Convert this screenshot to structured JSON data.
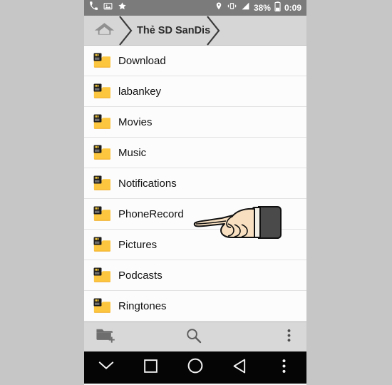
{
  "statusbar": {
    "left_icons": [
      "phone-handset-icon",
      "picture-icon",
      "star-icon"
    ],
    "right_icons": [
      "location-pin-icon",
      "vibrate-icon",
      "signal-bars-icon",
      "battery-icon"
    ],
    "battery_percent": "38%",
    "clock": "0:09"
  },
  "breadcrumb": {
    "home_icon": "home-icon",
    "items": [
      {
        "label": "Thẻ SD SanDis"
      }
    ]
  },
  "filelist": {
    "items": [
      {
        "name": "Download",
        "icon": "sd-folder-icon"
      },
      {
        "name": "labankey",
        "icon": "sd-folder-icon"
      },
      {
        "name": "Movies",
        "icon": "sd-folder-icon"
      },
      {
        "name": "Music",
        "icon": "sd-folder-icon"
      },
      {
        "name": "Notifications",
        "icon": "sd-folder-icon"
      },
      {
        "name": "PhoneRecord",
        "icon": "sd-folder-icon"
      },
      {
        "name": "Pictures",
        "icon": "sd-folder-icon"
      },
      {
        "name": "Podcasts",
        "icon": "sd-folder-icon"
      },
      {
        "name": "Ringtones",
        "icon": "sd-folder-icon"
      }
    ]
  },
  "toolbar": {
    "new_folder_icon": "new-folder-icon",
    "search_icon": "search-icon",
    "overflow_icon": "overflow-menu-icon"
  },
  "navbar": {
    "hide_keyboard_icon": "chevron-down-icon",
    "recents_icon": "square-recents-icon",
    "home_icon": "circle-home-icon",
    "back_icon": "triangle-back-icon",
    "overflow_icon": "overflow-menu-icon"
  },
  "cursor": {
    "icon": "pointing-hand-cursor",
    "points_at": "PhoneRecord"
  },
  "colors": {
    "page_background": "#c6c6c6",
    "statusbar_background": "#7b7b7b",
    "breadcrumb_background": "#d6d6d6",
    "list_background": "#fcfcfc",
    "toolbar_background": "#d8d8d8",
    "navbar_background": "#050505",
    "folder_yellow": "#fbc02d",
    "text_primary": "#111111"
  }
}
